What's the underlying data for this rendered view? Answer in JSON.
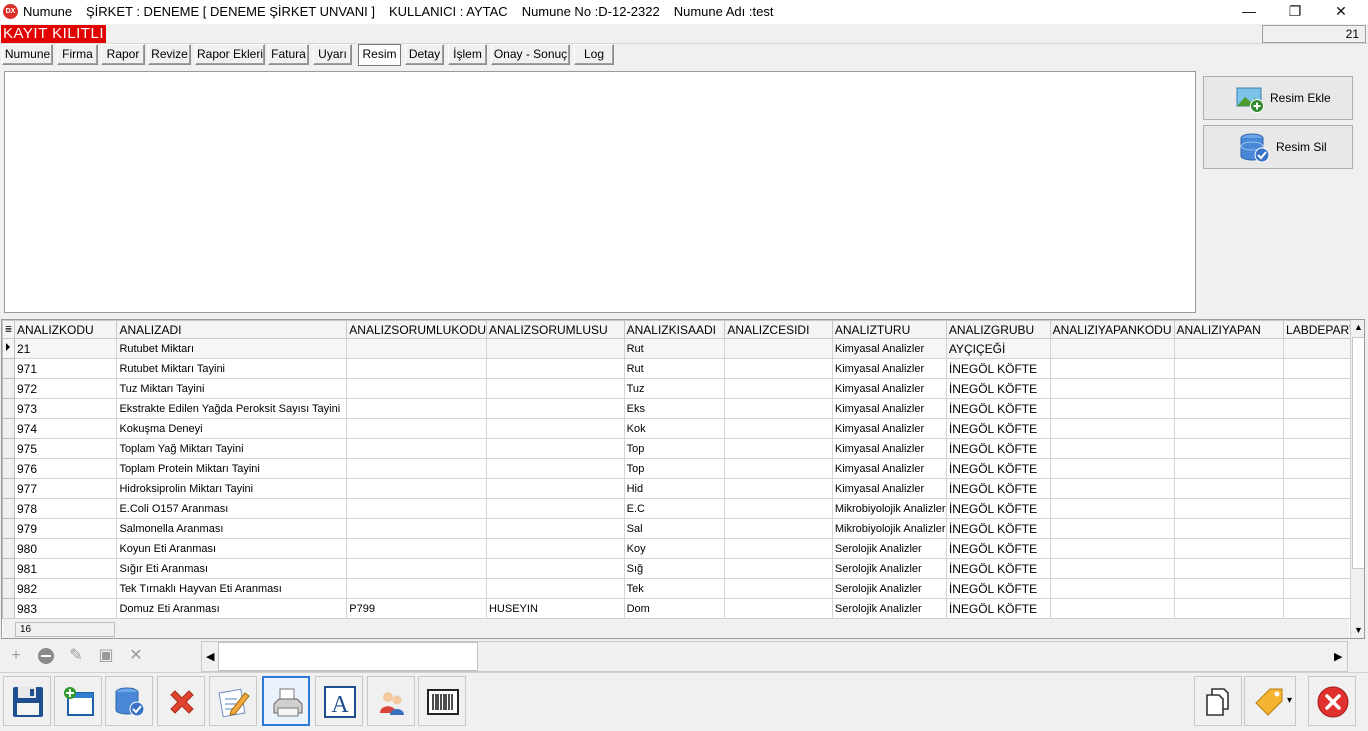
{
  "window": {
    "app_name": "Numune",
    "app_icon_text": "DX",
    "company": "ŞİRKET : DENEME [ DENEME ŞİRKET UNVANI ]",
    "user": "KULLANICI : AYTAC",
    "sample_no": "Numune No :D-12-2322",
    "sample_name": "Numune Adı :test",
    "minimize_glyph": "—",
    "maximize_glyph": "❐",
    "close_glyph": "✕"
  },
  "lock_banner": "KAYIT KILITLI",
  "record_count": "21",
  "tabs": [
    {
      "label": "Numune"
    },
    {
      "label": "Firma"
    },
    {
      "label": "Rapor"
    },
    {
      "label": "Revize"
    },
    {
      "label": "Rapor Ekleri"
    },
    {
      "label": "Fatura"
    },
    {
      "label": "Uyarı"
    },
    {
      "label": "Resim",
      "active": true
    },
    {
      "label": "Detay"
    },
    {
      "label": "İşlem"
    },
    {
      "label": "Onay - Sonuç"
    },
    {
      "label": "Log"
    }
  ],
  "image_buttons": {
    "add": "Resim Ekle",
    "delete": "Resim Sil"
  },
  "grid": {
    "columns": [
      "ANALIZKODU",
      "ANALIZADI",
      "ANALIZSORUMLUKODU",
      "ANALIZSORUMLUSU",
      "ANALIZKISAADI",
      "ANALIZCESIDI",
      "ANALIZTURU",
      "ANALIZGRUBU",
      "ANALIZIYAPANKODU",
      "ANALIZIYAPAN",
      "LABDEPARTI"
    ],
    "rows": [
      [
        "21",
        "Rutubet Miktarı",
        "",
        "",
        "Rut",
        "",
        "Kimyasal Analizler",
        "AYÇIÇEĞİ",
        "",
        "",
        ""
      ],
      [
        "971",
        "Rutubet Miktarı Tayini",
        "",
        "",
        "Rut",
        "",
        "Kimyasal Analizler",
        "İNEGÖL KÖFTE",
        "",
        "",
        ""
      ],
      [
        "972",
        "Tuz Miktarı Tayini",
        "",
        "",
        "Tuz",
        "",
        "Kimyasal Analizler",
        "İNEGÖL KÖFTE",
        "",
        "",
        ""
      ],
      [
        "973",
        "Ekstrakte Edilen Yağda Peroksit Sayısı Tayini",
        "",
        "",
        "Eks",
        "",
        "Kimyasal Analizler",
        "İNEGÖL KÖFTE",
        "",
        "",
        ""
      ],
      [
        "974",
        "Kokuşma Deneyi",
        "",
        "",
        "Kok",
        "",
        "Kimyasal Analizler",
        "İNEGÖL KÖFTE",
        "",
        "",
        ""
      ],
      [
        "975",
        "Toplam Yağ Miktarı Tayini",
        "",
        "",
        "Top",
        "",
        "Kimyasal Analizler",
        "İNEGÖL KÖFTE",
        "",
        "",
        ""
      ],
      [
        "976",
        "Toplam Protein Miktarı Tayini",
        "",
        "",
        "Top",
        "",
        "Kimyasal Analizler",
        "İNEGÖL KÖFTE",
        "",
        "",
        ""
      ],
      [
        "977",
        "Hidroksiprolin Miktarı Tayini",
        "",
        "",
        "Hid",
        "",
        "Kimyasal Analizler",
        "İNEGÖL KÖFTE",
        "",
        "",
        ""
      ],
      [
        "978",
        "E.Coli O157 Aranması",
        "",
        "",
        "E.C",
        "",
        "Mikrobiyolojik Analizler",
        "İNEGÖL KÖFTE",
        "",
        "",
        ""
      ],
      [
        "979",
        "Salmonella Aranması",
        "",
        "",
        "Sal",
        "",
        "Mikrobiyolojik Analizler",
        "İNEGÖL KÖFTE",
        "",
        "",
        ""
      ],
      [
        "980",
        "Koyun Eti Aranması",
        "",
        "",
        "Koy",
        "",
        "Serolojik Analizler",
        "İNEGÖL KÖFTE",
        "",
        "",
        ""
      ],
      [
        "981",
        "Sığır Eti Aranması",
        "",
        "",
        "Sığ",
        "",
        "Serolojik Analizler",
        "İNEGÖL KÖFTE",
        "",
        "",
        ""
      ],
      [
        "982",
        "Tek Tırnaklı Hayvan Eti Aranması",
        "",
        "",
        "Tek",
        "",
        "Serolojik Analizler",
        "İNEGÖL KÖFTE",
        "",
        "",
        ""
      ],
      [
        "983",
        "Domuz Eti Aranması",
        "P799",
        "HUSEYIN",
        "Dom",
        "",
        "Serolojik Analizler",
        "İNEGÖL KÖFTE",
        "",
        "",
        ""
      ]
    ],
    "footer_count": "16"
  },
  "navigator": {
    "add": "+",
    "remove": "−",
    "edit": "✎",
    "save": "▣",
    "cancel": "✕"
  },
  "toolbar": {
    "icons": [
      "save-icon",
      "new-window-icon",
      "delete-db-icon",
      "cancel-x-icon",
      "edit-icon",
      "print-icon",
      "text-a-icon",
      "users-icon",
      "barcode-icon",
      "copy-icon",
      "tag-icon",
      "close-icon"
    ],
    "text_icon_letter": "A",
    "close_glyph": "✕",
    "dropdown_glyph": "▾"
  },
  "colors": {
    "lock_red": "#e20000",
    "active_blue": "#2d79d7",
    "close_red": "#e0312f"
  }
}
